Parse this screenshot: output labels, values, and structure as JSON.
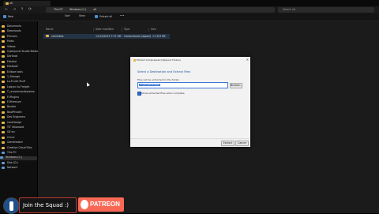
{
  "window": {
    "tab_label": "uti",
    "minimize": "—",
    "maximize": "□",
    "close": "✕"
  },
  "address": {
    "back": "←",
    "forward": "→",
    "up": "↑",
    "refresh": "⟳",
    "crumbs": [
      "This PC",
      "Windows (C:)",
      "uti"
    ],
    "search_placeholder": "Search uti"
  },
  "toolbar": {
    "new": "New",
    "sort": "Sort",
    "view": "View",
    "extract_all": "Extract all",
    "more": "•••"
  },
  "sidebar": {
    "items": [
      "Documents",
      "Downloads",
      "Pictures",
      "Music",
      "Videos",
      "Cyberpunk Studio Media",
      "Darkcod",
      "Edstiod",
      "Edstiod2",
      "Eclipse tools",
      "1_Storage",
      "Lo-Fi-Lite Stuff",
      "Lipsync to Freight",
      "T_uncommon/byteme",
      "FLPlugins",
      "FLPremium",
      "Bouble",
      "BootPrivate",
      "Dev Engineers",
      "CoreDesign",
      "TIT Obsessed",
      "Gif src",
      "Cricut",
      "Gameheater",
      "Creative Cloud Files",
      "This PC",
      "Windows (C:)",
      "Disk (D:)",
      "Network"
    ]
  },
  "content": {
    "columns": [
      "Name",
      "Date modified",
      "Type",
      "Size"
    ],
    "file": {
      "name": "uiminibox",
      "date": "11/13/2023 7:37 AM",
      "type": "Compressed (zipped)",
      "size": "17,423 KB"
    }
  },
  "dialog": {
    "title": "Extract Compressed (Zipped) Folders",
    "close": "✕",
    "heading": "Select a Destination and Extract Files",
    "label": "Files will be extracted to this folder:",
    "path": "C:\\uti\\uiminibox",
    "browse": "Browse...",
    "checkbox_label": "Show extracted files when complete",
    "extract": "Extract",
    "cancel": "Cancel"
  },
  "overlay": {
    "join": "Join the Squad :)",
    "patreon": "PATREON"
  }
}
